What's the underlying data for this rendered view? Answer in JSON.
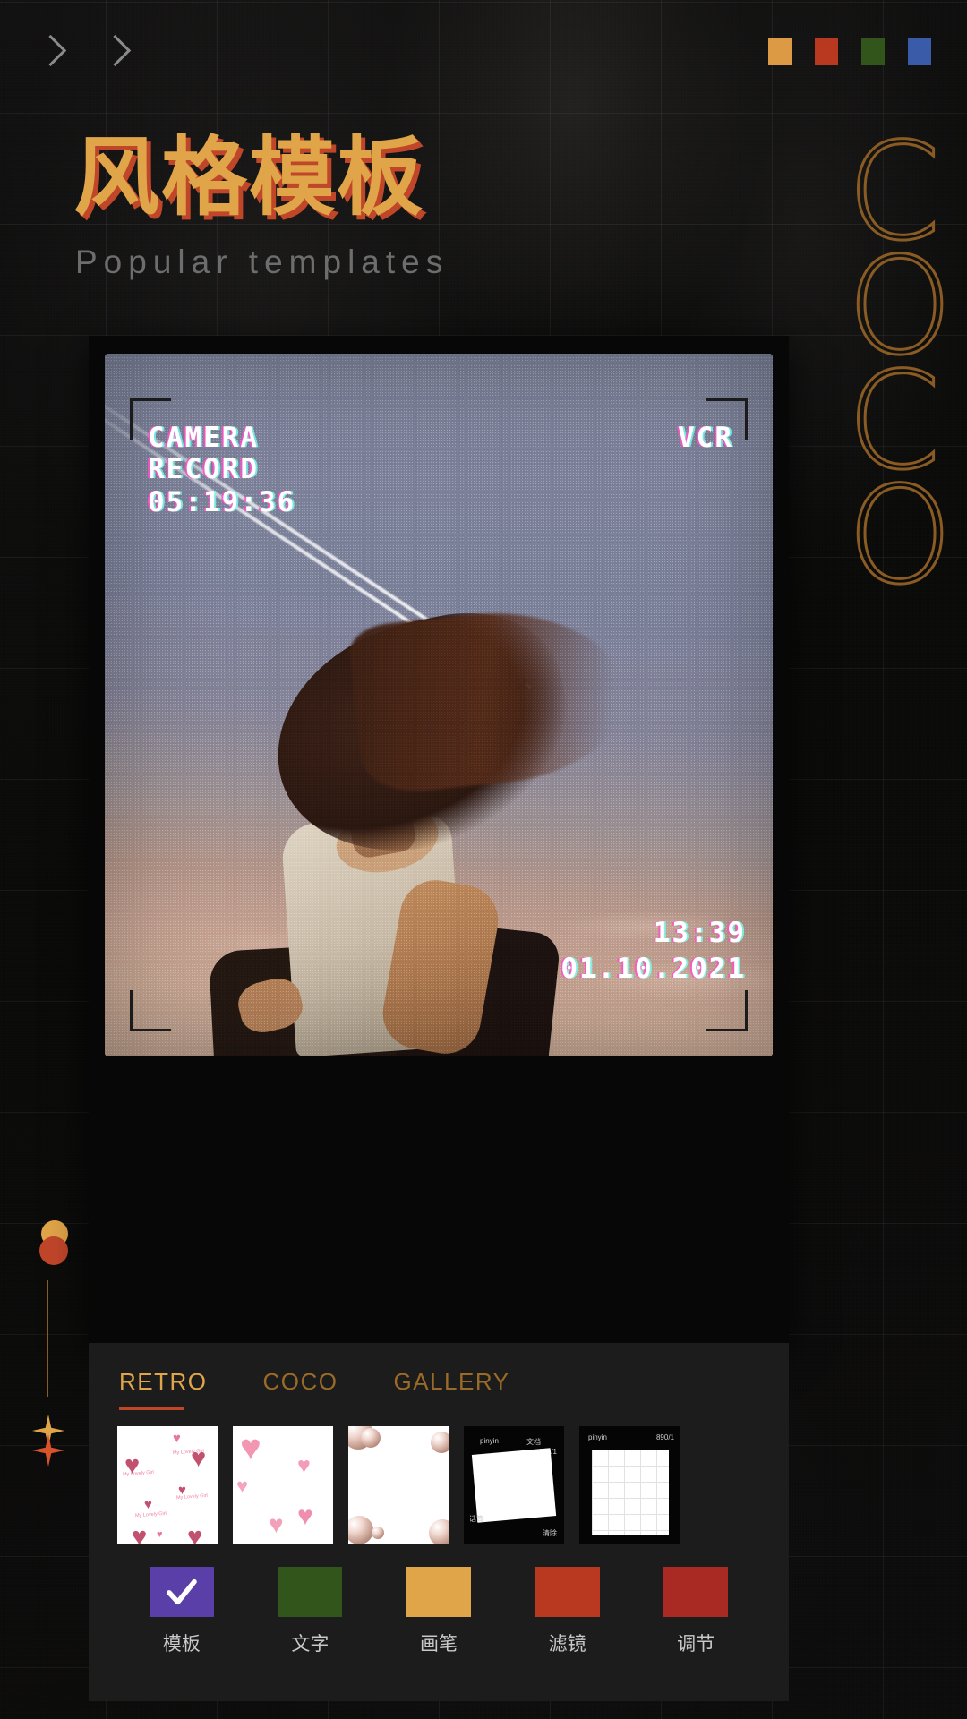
{
  "header": {
    "chevron_1": "chevron-right",
    "chevron_2": "chevron-right",
    "swatches": [
      {
        "name": "amber",
        "color": "#dd9a44"
      },
      {
        "name": "red",
        "color": "#b8391f"
      },
      {
        "name": "green",
        "color": "#32551b"
      },
      {
        "name": "blue",
        "color": "#3a5ba8"
      }
    ]
  },
  "hero": {
    "title": "风格模板",
    "subtitle": "Popular templates",
    "title_color": "#e0a449",
    "title_shadow_color": "#c0462a",
    "rail_letters": [
      "C",
      "O",
      "C",
      "O"
    ],
    "rail_color": "#8a5c24"
  },
  "preview": {
    "hud": {
      "camera": "CAMERA",
      "record": "RECORD",
      "timecode": "05:19:36",
      "mode": "VCR",
      "clock": "13:39",
      "date": "01.10.2021"
    }
  },
  "panel": {
    "tabs": [
      {
        "label": "RETRO",
        "active": true
      },
      {
        "label": "COCO",
        "active": false
      },
      {
        "label": "GALLERY",
        "active": false
      }
    ],
    "tab_active_color": "#e0a449",
    "tab_inactive_color": "#9a6a28",
    "tab_underline_color": "#c0462a",
    "thumbnails": [
      {
        "name": "hearts-small-pattern",
        "caption": "My Lovely Girl"
      },
      {
        "name": "hearts-3d-pink"
      },
      {
        "name": "pearls-bubbles"
      },
      {
        "name": "phone-screen-dark",
        "texts": [
          "pinyin",
          "文档",
          "890/1",
          "话筒",
          "清除"
        ]
      },
      {
        "name": "phone-screen-grid",
        "texts": [
          "pinyin",
          "890/1"
        ]
      }
    ],
    "tools": [
      {
        "label": "模板",
        "color": "#5b3fa8",
        "icon": "check-icon",
        "selected": true
      },
      {
        "label": "文字",
        "color": "#32551b",
        "icon": "",
        "selected": false
      },
      {
        "label": "画笔",
        "color": "#e0a449",
        "icon": "",
        "selected": false
      },
      {
        "label": "滤镜",
        "color": "#b8391f",
        "icon": "",
        "selected": false
      },
      {
        "label": "调节",
        "color": "#a82a22",
        "icon": "",
        "selected": false
      }
    ]
  },
  "decorations": {
    "dot_amber": "#e0a449",
    "dot_red": "#c0462a",
    "line_color": "#8a5c24",
    "sparkle_amber": "#e0a449",
    "sparkle_red": "#d9532a"
  }
}
